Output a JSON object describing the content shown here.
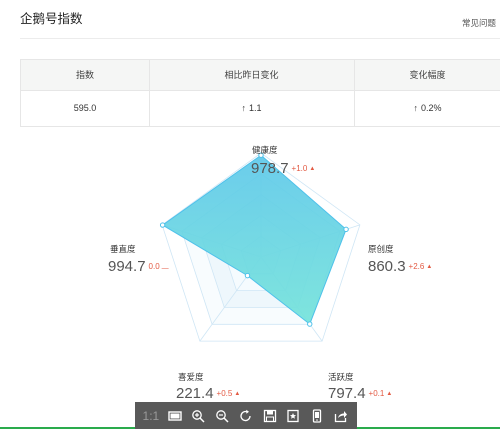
{
  "header": {
    "title": "企鹅号指数",
    "faq_label": "常见问题"
  },
  "stats": {
    "columns": [
      "指数",
      "相比昨日变化",
      "变化幅度"
    ],
    "index_value": "595.0",
    "change_value": "1.1",
    "change_arrow": "↑",
    "rate_value": "0.2%",
    "rate_arrow": "↑"
  },
  "radar": {
    "dimensions": [
      {
        "name": "健康度",
        "value": "978.7",
        "delta": "+1.0",
        "trend": "▲"
      },
      {
        "name": "原创度",
        "value": "860.3",
        "delta": "+2.6",
        "trend": "▲"
      },
      {
        "name": "活跃度",
        "value": "797.4",
        "delta": "+0.1",
        "trend": "▲"
      },
      {
        "name": "喜爱度",
        "value": "221.4",
        "delta": "+0.5",
        "trend": "▲"
      },
      {
        "name": "垂直度",
        "value": "994.7",
        "delta": "0.0",
        "trend": "—"
      }
    ],
    "colors": {
      "fill_top": "#5ec8ea",
      "fill_bottom": "#74e3da",
      "delta_up": "#e35a43",
      "grid": "#cfe6f5"
    }
  },
  "toolbar": {
    "items": [
      {
        "name": "actual-size-button",
        "label": "1:1"
      },
      {
        "name": "fit-screen-button",
        "icon": "screen-icon"
      },
      {
        "name": "zoom-in-button",
        "icon": "zoom-in-icon"
      },
      {
        "name": "zoom-out-button",
        "icon": "zoom-out-icon"
      },
      {
        "name": "rotate-button",
        "icon": "rotate-icon"
      },
      {
        "name": "save-button",
        "icon": "save-icon"
      },
      {
        "name": "bookmark-button",
        "icon": "bookmark-icon"
      },
      {
        "name": "phone-button",
        "icon": "phone-icon"
      },
      {
        "name": "share-button",
        "icon": "share-icon"
      }
    ]
  }
}
